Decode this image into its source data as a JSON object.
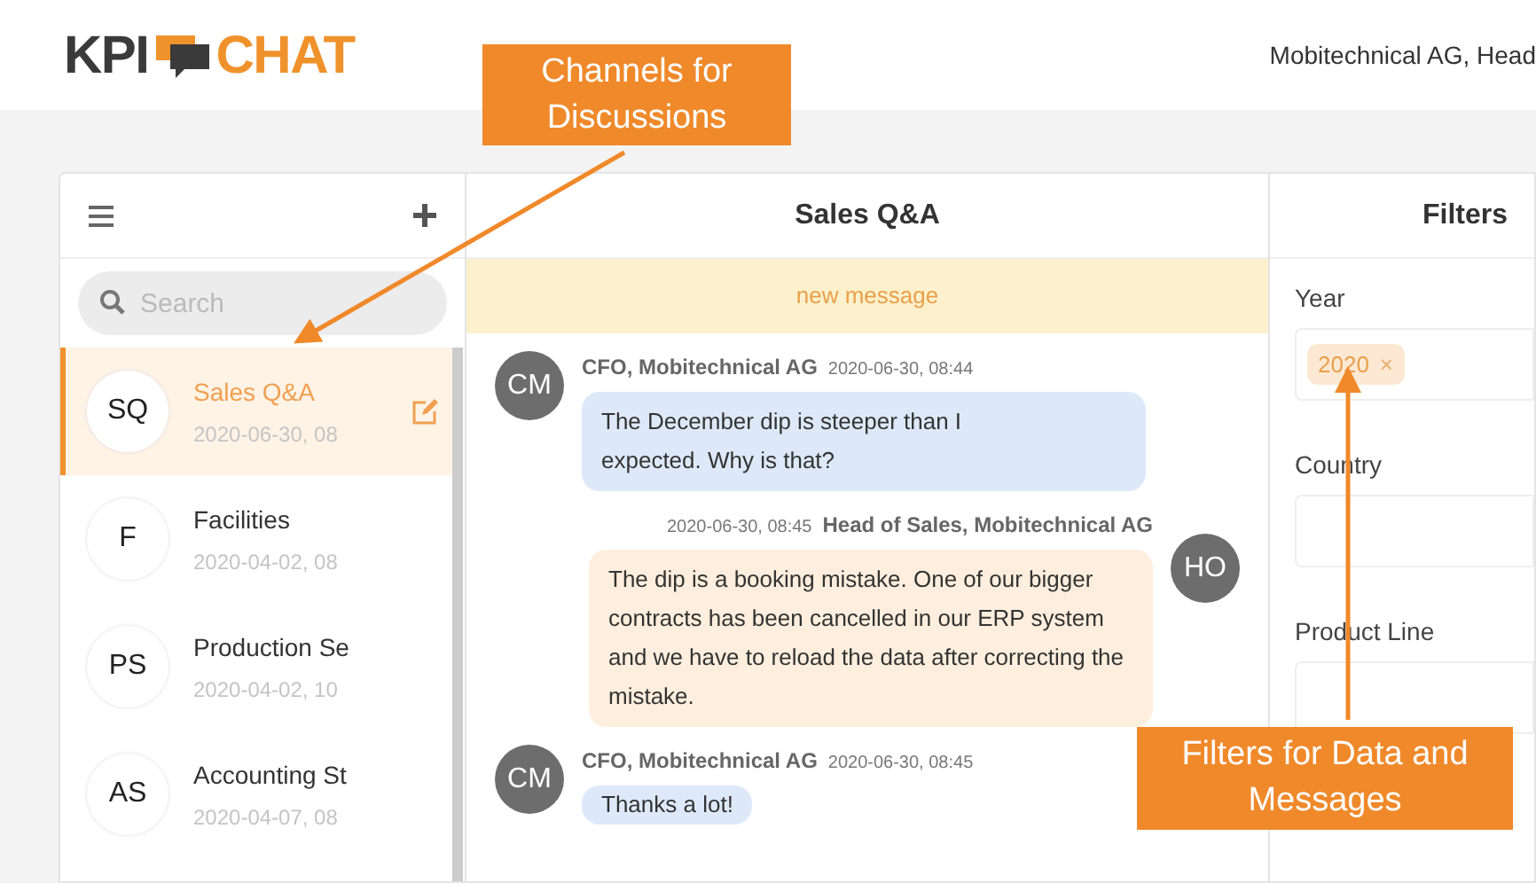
{
  "header": {
    "logo": {
      "left": "KPI",
      "right": "CHAT"
    },
    "user": "Mobitechnical AG, Head"
  },
  "sidebar": {
    "search": {
      "placeholder": "Search"
    },
    "channels": [
      {
        "initials": "SQ",
        "name": "Sales Q&A",
        "date": "2020-06-30, 08",
        "selected": true
      },
      {
        "initials": "F",
        "name": "Facilities",
        "date": "2020-04-02, 08",
        "selected": false
      },
      {
        "initials": "PS",
        "name": "Production Se",
        "date": "2020-04-02, 10",
        "selected": false
      },
      {
        "initials": "AS",
        "name": "Accounting St",
        "date": "2020-04-07, 08",
        "selected": false
      }
    ]
  },
  "chat": {
    "title": "Sales Q&A",
    "banner": "new message",
    "messages": [
      {
        "initials": "CM",
        "author": "CFO, Mobitechnical AG",
        "time": "2020-06-30, 08:44",
        "text": "The December dip is steeper than I expected. Why is that?",
        "own": false
      },
      {
        "initials": "HO",
        "author": "Head of Sales, Mobitechnical AG",
        "time": "2020-06-30, 08:45",
        "text": "The dip is a booking mistake. One of our bigger contracts has been cancelled in our ERP system and we have to reload the data after correcting the mistake.",
        "own": true
      },
      {
        "initials": "CM",
        "author": "CFO, Mobitechnical AG",
        "time": "2020-06-30, 08:45",
        "text": "Thanks a lot!",
        "own": false
      }
    ]
  },
  "filters": {
    "title": "Filters",
    "fields": [
      {
        "label": "Year",
        "chips": [
          {
            "label": "2020",
            "remove": "×"
          }
        ]
      },
      {
        "label": "Country"
      },
      {
        "label": "Product Line"
      }
    ]
  },
  "callouts": [
    {
      "text": "Channels for Discussions"
    },
    {
      "text": "Filters for Data and Messages"
    }
  ]
}
